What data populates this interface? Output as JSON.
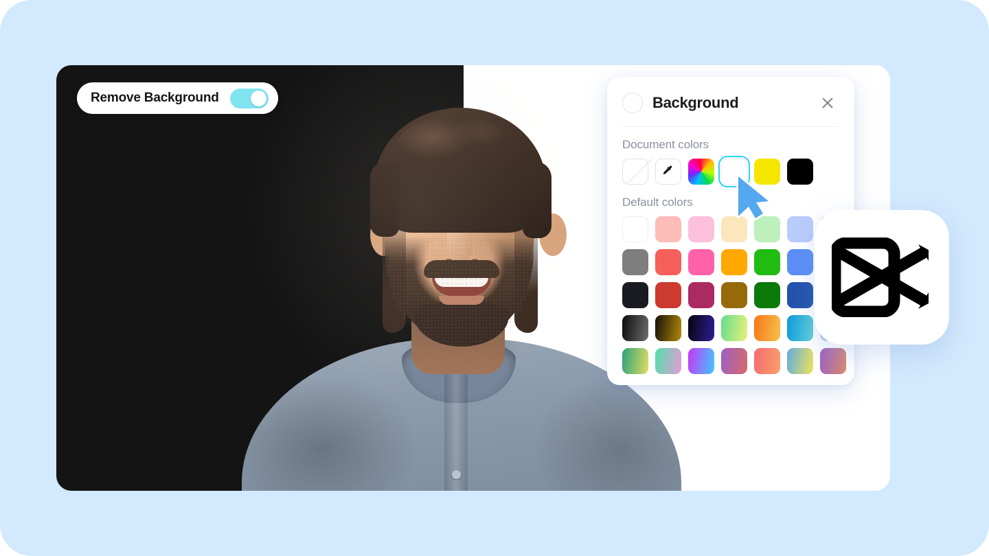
{
  "page": {
    "background_color": "#d3e9fd",
    "canvas_background": "#ffffff"
  },
  "editor": {
    "canvas_dark_color": "#141414",
    "remove_background": {
      "label": "Remove Background",
      "toggle_state": "on",
      "toggle_on_color": "#7fe3f0",
      "icon": "toggle-switch-icon"
    }
  },
  "panel": {
    "title": "Background",
    "title_icon": "circle-swatch-icon",
    "close_icon": "close-x-icon",
    "sections": [
      {
        "label": "Document colors",
        "swatches": [
          {
            "name": "transparent",
            "type": "outline",
            "icon": "no-color-icon",
            "color": "transparent"
          },
          {
            "name": "eyedropper",
            "type": "tool",
            "icon": "eyedropper-icon",
            "color": "#ffffff"
          },
          {
            "name": "custom-color-picker",
            "type": "rainbow",
            "icon": "color-wheel-icon",
            "color": "rainbow"
          },
          {
            "name": "white",
            "type": "solid",
            "color": "#ffffff",
            "selected": true
          },
          {
            "name": "yellow",
            "type": "solid",
            "color": "#f5e600"
          },
          {
            "name": "black",
            "type": "solid",
            "color": "#000000"
          }
        ]
      },
      {
        "label": "Default colors",
        "rows": [
          [
            {
              "color": "#ffffff",
              "name": "white"
            },
            {
              "color": "#fcbcb8",
              "name": "light-salmon"
            },
            {
              "color": "#fcc0dd",
              "name": "light-pink"
            },
            {
              "color": "#fce6bc",
              "name": "light-peach"
            },
            {
              "color": "#bdf0bc",
              "name": "light-green"
            },
            {
              "color": "#b9ccfb",
              "name": "light-blue"
            },
            {
              "color": "#d9c8f7",
              "name": "light-purple"
            }
          ],
          [
            {
              "color": "#7e7e7e",
              "name": "gray"
            },
            {
              "color": "#f5605a",
              "name": "red"
            },
            {
              "color": "#ff62a8",
              "name": "pink"
            },
            {
              "color": "#ffa800",
              "name": "orange"
            },
            {
              "color": "#22bb11",
              "name": "green"
            },
            {
              "color": "#5b8ef7",
              "name": "blue"
            },
            {
              "color": "#9b6bf0",
              "name": "purple"
            }
          ],
          [
            {
              "color": "#191b21",
              "name": "near-black"
            },
            {
              "color": "#cc3a30",
              "name": "brick-red"
            },
            {
              "color": "#ab2a62",
              "name": "magenta"
            },
            {
              "color": "#96690b",
              "name": "olive-brown"
            },
            {
              "color": "#0b7a0b",
              "name": "dark-green"
            },
            {
              "color": "#2352ac",
              "name": "navy-blue"
            },
            {
              "color": "#5b2fa8",
              "name": "dark-purple"
            }
          ],
          [
            {
              "gradient": "linear-gradient(100deg,#0c0c0c,#6d6d6d)",
              "name": "black-gray-gradient"
            },
            {
              "gradient": "linear-gradient(100deg,#141008,#b48a0c)",
              "name": "black-gold-gradient"
            },
            {
              "gradient": "linear-gradient(100deg,#06030f,#2c1f94)",
              "name": "black-indigo-gradient"
            },
            {
              "gradient": "linear-gradient(100deg,#63dd8f,#eaf07a)",
              "name": "green-yellow-gradient"
            },
            {
              "gradient": "linear-gradient(100deg,#f97516,#f5c24a)",
              "name": "orange-gradient"
            },
            {
              "gradient": "linear-gradient(100deg,#0d9ade,#63d0d8)",
              "name": "blue-cyan-gradient"
            },
            {
              "gradient": "linear-gradient(100deg,#b7c8f7,#cfd9fb)",
              "name": "pale-blue-gradient"
            }
          ],
          [
            {
              "gradient": "linear-gradient(100deg,#2aa37a,#e3dc62)",
              "name": "teal-yellow-gradient"
            },
            {
              "gradient": "linear-gradient(100deg,#52e0a8,#e59ad8)",
              "name": "mint-pink-gradient"
            },
            {
              "gradient": "linear-gradient(100deg,#c936f5,#3fc8ff)",
              "name": "purple-cyan-gradient"
            },
            {
              "gradient": "linear-gradient(100deg,#9c5fc4,#d66a6a)",
              "name": "purple-red-gradient"
            },
            {
              "gradient": "linear-gradient(100deg,#f76a72,#f8a06a)",
              "name": "coral-gradient"
            },
            {
              "gradient": "linear-gradient(100deg,#62aede,#f2e35a)",
              "name": "blue-yellow-gradient"
            },
            {
              "gradient": "linear-gradient(100deg,#9c62c6,#dd8a6a)",
              "name": "violet-orange-gradient"
            }
          ]
        ]
      }
    ]
  },
  "cursor": {
    "icon": "arrow-pointer-icon",
    "fill_color": "#54a8f0",
    "stroke_color": "#ffffff"
  },
  "badge": {
    "name": "capcut-logo",
    "icon": "capcut-logo-icon",
    "mark_color": "#000000",
    "background_color": "#ffffff"
  }
}
